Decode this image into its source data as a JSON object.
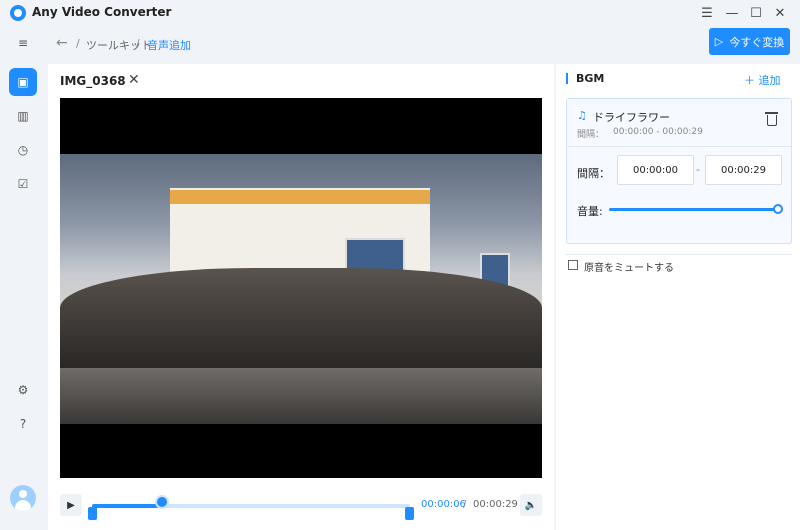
{
  "window": {
    "title": "Any Video Converter",
    "controls": [
      "menu-icon",
      "minimize-icon",
      "maximize-icon",
      "close-icon"
    ]
  },
  "rail": {
    "items": [
      {
        "icon": "collapse-sidebar-icon",
        "active": false
      },
      {
        "icon": "toolbox-icon",
        "active": true
      },
      {
        "icon": "library-icon",
        "active": false
      },
      {
        "icon": "history-icon",
        "active": false
      },
      {
        "icon": "tasks-icon",
        "active": false
      },
      {
        "icon": "settings-icon",
        "active": false
      },
      {
        "icon": "help-icon",
        "active": false
      },
      {
        "icon": "user-avatar-icon",
        "active": false
      }
    ]
  },
  "nav": {
    "breadcrumb": [
      "ツールキット",
      "音声追加"
    ],
    "convert_label": "今すぐ変換"
  },
  "editor": {
    "file_name": "IMG_0368",
    "current_time": "00:00:06",
    "time_separator": "/",
    "total_time": "00:00:29",
    "playhead_fraction": 0.22,
    "selection": [
      0.0,
      1.0
    ]
  },
  "bgm": {
    "title": "BGM",
    "add_label": "追加",
    "track": {
      "name": "ドライフラワー",
      "interval_label_small": "間隔：",
      "interval_value_small": "00:00:00 - 00:00:29",
      "interval_label": "間隔：",
      "start": "00:00:00",
      "end": "00:00:29",
      "volume_label": "音量:",
      "volume_fraction": 1.0
    },
    "mute_label": "原音をミュートする",
    "mute_checked": false
  },
  "colors": {
    "accent": "#1f8cff",
    "background": "#f0f3f8"
  }
}
